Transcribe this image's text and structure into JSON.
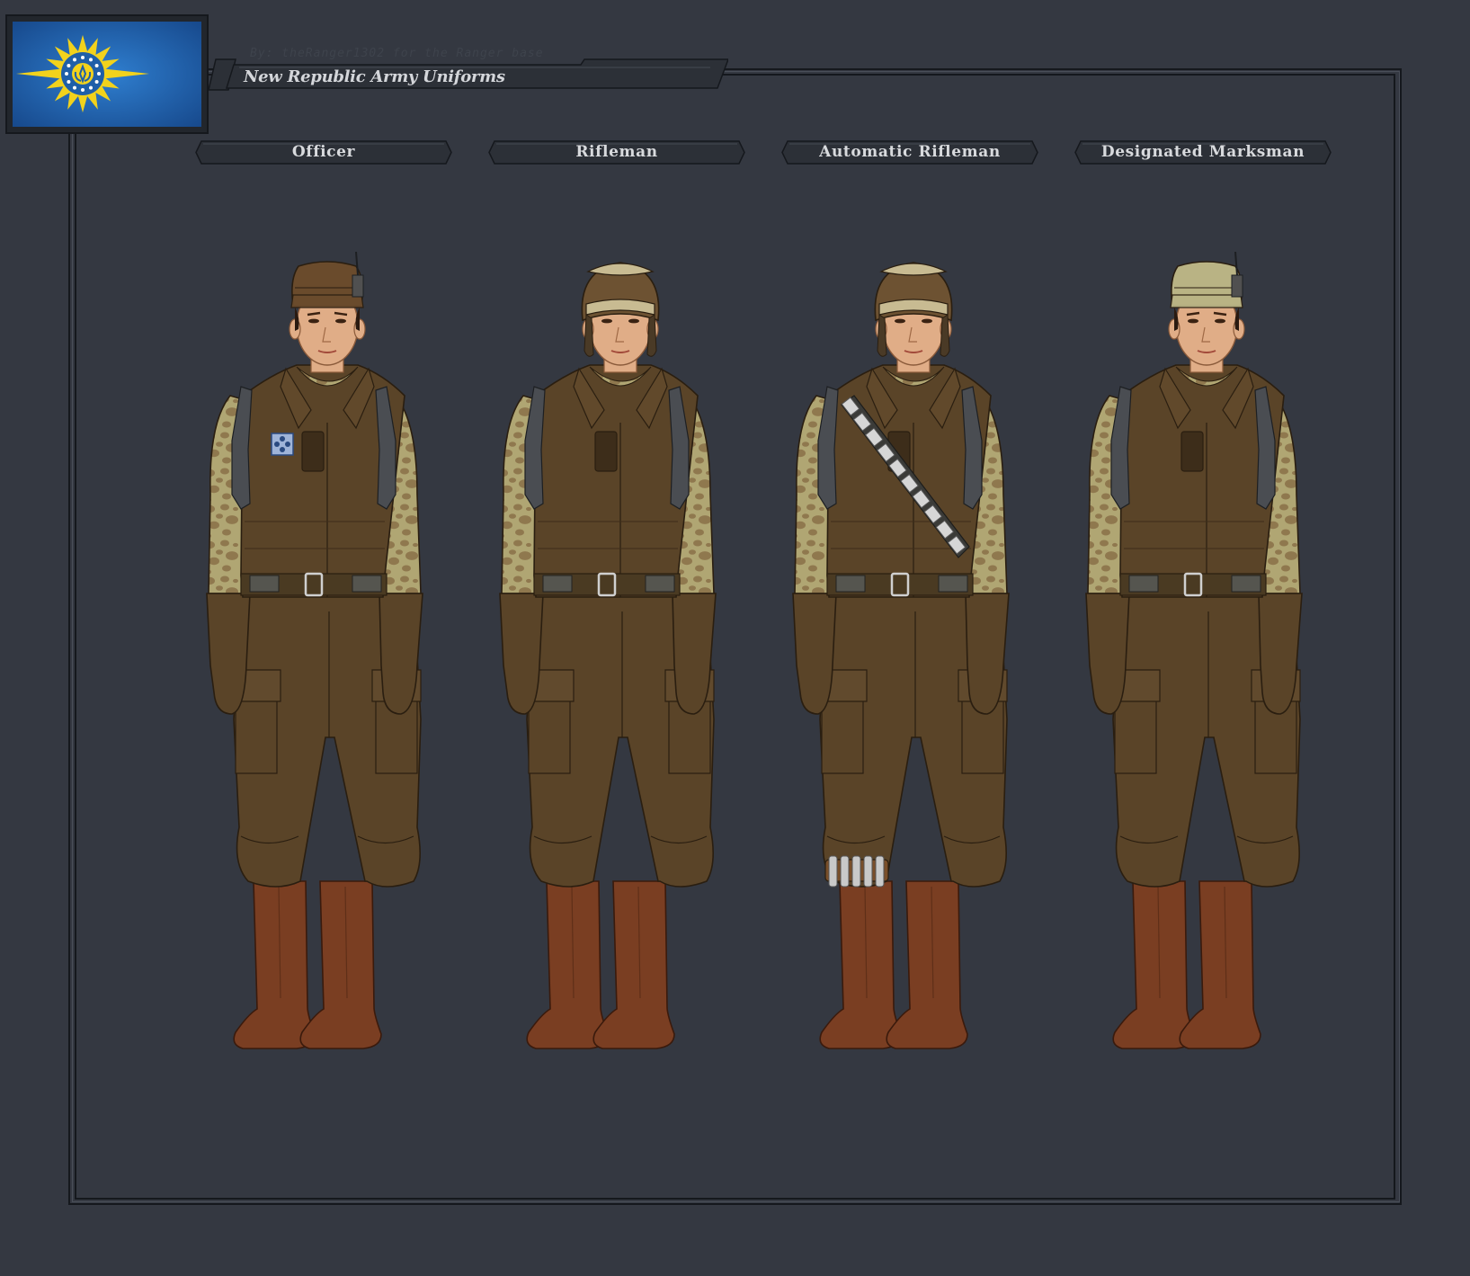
{
  "credit": "By: theRanger1302 for the Ranger base",
  "title": "New Republic Army Uniforms",
  "roles": [
    {
      "label": "Officer",
      "headgear": "cap",
      "cap_color": "#6a4b2c",
      "rank_patch": true,
      "bandolier": false,
      "leg_pouches": false,
      "radio": true
    },
    {
      "label": "Rifleman",
      "headgear": "helmet",
      "cap_color": "#6a4b2c",
      "rank_patch": false,
      "bandolier": false,
      "leg_pouches": false,
      "radio": false
    },
    {
      "label": "Automatic Rifleman",
      "headgear": "helmet",
      "cap_color": "#6a4b2c",
      "rank_patch": false,
      "bandolier": true,
      "leg_pouches": true,
      "radio": false
    },
    {
      "label": "Designated Marksman",
      "headgear": "cap",
      "cap_color": "#b9b384",
      "rank_patch": false,
      "bandolier": false,
      "leg_pouches": false,
      "radio": true
    }
  ],
  "colors": {
    "background": "#343841",
    "uniform": "#5a4428",
    "uniform_dark": "#3d2d1a",
    "camo_base": "#b0a673",
    "camo_spot": "#8a7048",
    "boots": "#7a3e22",
    "skin": "#e0ad87",
    "flag_blue": "#1f5fa8",
    "flag_gold": "#f2d21c"
  },
  "icons": {
    "flag": "new-republic-flag-icon",
    "rank": "rank-patch-icon"
  }
}
